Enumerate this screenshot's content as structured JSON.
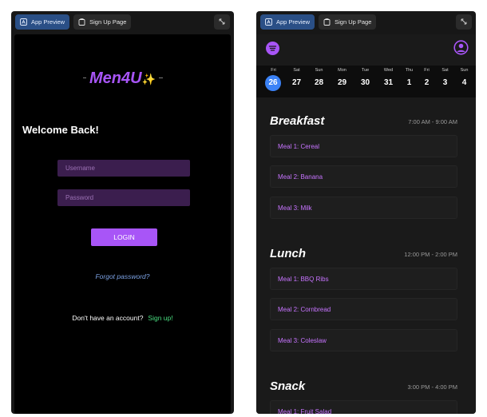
{
  "left_window": {
    "tabs": [
      {
        "label": "App Preview",
        "active": true
      },
      {
        "label": "Sign Up Page",
        "active": false
      }
    ],
    "login": {
      "brand": "Men4U",
      "brand_sparkle": "✨",
      "welcome": "Welcome Back!",
      "username_placeholder": "Username",
      "password_placeholder": "Password",
      "login_label": "LOGIN",
      "forgot_label": "Forgot password?",
      "signup_prompt": "Don't have an account?",
      "signup_link": "Sign up!"
    }
  },
  "right_window": {
    "tabs": [
      {
        "label": "App Preview",
        "active": true
      },
      {
        "label": "Sign Up Page",
        "active": false
      }
    ],
    "dates": [
      {
        "day": "Fri",
        "num": "26",
        "selected": true
      },
      {
        "day": "Sat",
        "num": "27"
      },
      {
        "day": "Sun",
        "num": "28"
      },
      {
        "day": "Mon",
        "num": "29"
      },
      {
        "day": "Tue",
        "num": "30"
      },
      {
        "day": "Wed",
        "num": "31"
      },
      {
        "day": "Thu",
        "num": "1"
      },
      {
        "day": "Fri",
        "num": "2"
      },
      {
        "day": "Sat",
        "num": "3"
      },
      {
        "day": "Sun",
        "num": "4"
      }
    ],
    "sections": [
      {
        "title": "Breakfast",
        "time": "7:00 AM - 9:00 AM",
        "meals": [
          "Meal 1: Cereal",
          "Meal 2: Banana",
          "Meal 3: Milk"
        ]
      },
      {
        "title": "Lunch",
        "time": "12:00 PM - 2:00 PM",
        "meals": [
          "Meal 1: BBQ Ribs",
          "Meal 2: Cornbread",
          "Meal 3: Coleslaw"
        ]
      },
      {
        "title": "Snack",
        "time": "3:00 PM - 4:00 PM",
        "meals": [
          "Meal 1: Fruit Salad"
        ]
      }
    ]
  },
  "colors": {
    "accent_purple": "#a855f7",
    "tab_active": "#2a4f86",
    "link_blue": "#7ca2e4",
    "link_green": "#4ade80",
    "selected_date": "#3b82f6"
  },
  "icons": [
    "app-preview-icon",
    "file-icon",
    "expand-icon",
    "menu-icon",
    "profile-icon"
  ]
}
